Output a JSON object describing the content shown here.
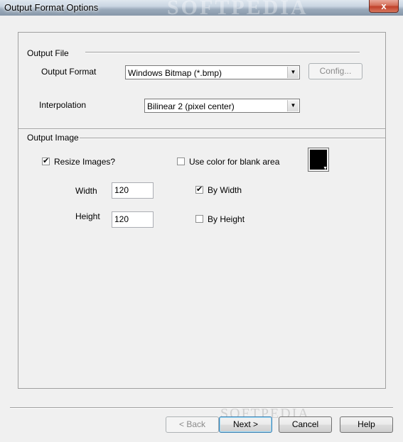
{
  "window": {
    "title": "Output Format Options",
    "close_label": "x",
    "watermark": "SOFTPEDIA"
  },
  "output_file": {
    "group_label": "Output File",
    "format_label": "Output Format",
    "format_value": "Windows Bitmap (*.bmp)",
    "config_label": "Config...",
    "interpolation_label": "Interpolation",
    "interpolation_value": "Bilinear 2 (pixel center)"
  },
  "output_image": {
    "group_label": "Output Image",
    "resize_label": "Resize Images?",
    "resize_checked": true,
    "blank_color_label": "Use color for blank area",
    "blank_color_checked": false,
    "blank_color": "#000000",
    "width_label": "Width",
    "width_value": "120",
    "height_label": "Height",
    "height_value": "120",
    "by_width_label": "By Width",
    "by_width_checked": true,
    "by_height_label": "By Height",
    "by_height_checked": false
  },
  "footer": {
    "back_label": "< Back",
    "next_label": "Next >",
    "cancel_label": "Cancel",
    "help_label": "Help",
    "watermark": "SOFTPEDIA"
  },
  "icons": {
    "dropdown": "chevron-down-icon",
    "check": "checkmark-icon"
  }
}
